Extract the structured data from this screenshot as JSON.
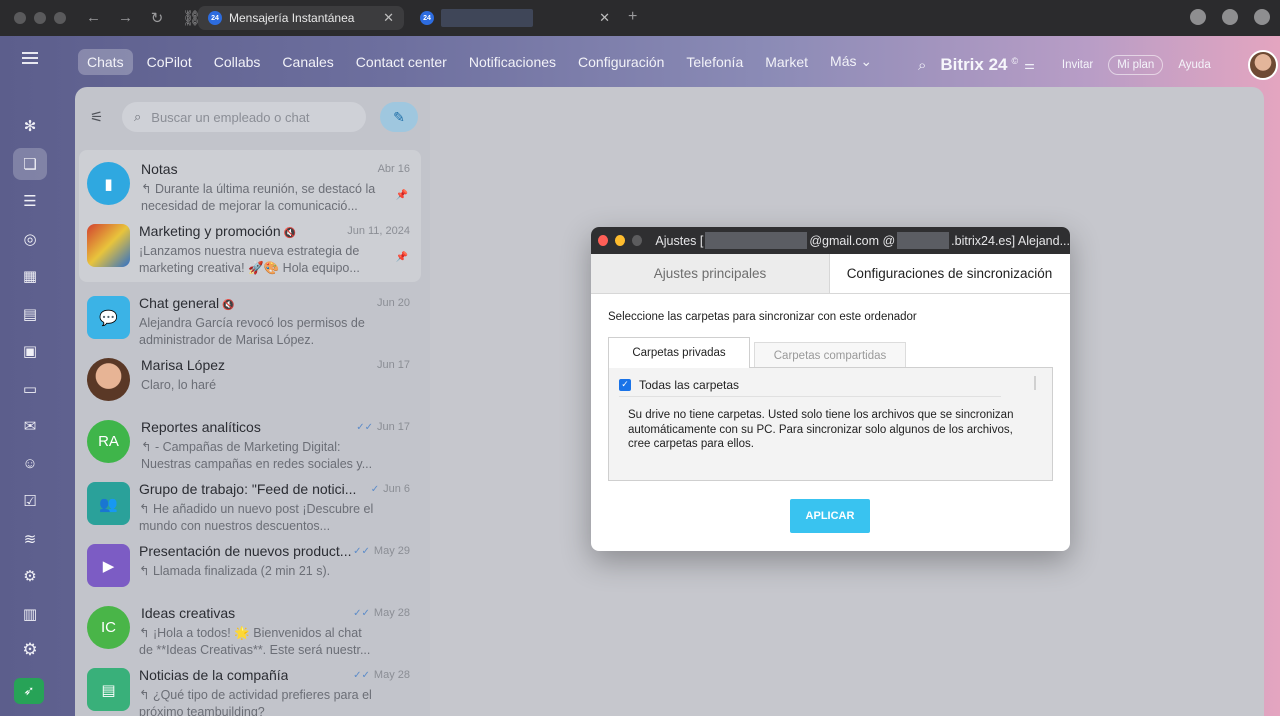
{
  "browser": {
    "tabs": [
      {
        "label": "Mensajería Instantánea",
        "favicon": "24"
      },
      {
        "label": "",
        "favicon": "24"
      }
    ],
    "close_glyph": "✕",
    "new_tab_glyph": "+"
  },
  "topnav": {
    "items": [
      "Chats",
      "CoPilot",
      "Collabs",
      "Canales",
      "Contact center",
      "Notificaciones",
      "Configuración",
      "Telefonía",
      "Market",
      "Más ⌄"
    ],
    "brand": "Bitrix 24",
    "brand_sup": "©",
    "invite": "Invitar",
    "plan": "Mi plan",
    "help": "Ayuda"
  },
  "search": {
    "placeholder": "Buscar un empleado o chat"
  },
  "chats": [
    {
      "title": "Notas",
      "date": "Abr 16",
      "preview": "↰ Durante la última reunión, se destacó la necesidad de mejorar la comunicació...",
      "pinned": true,
      "avatar": "bookmark-icon",
      "color": "#2fa8e0"
    },
    {
      "title": "Marketing y promoción",
      "date": "Jun 11, 2024",
      "preview": "¡Lanzamos nuestra nueva estrategia de marketing creativa! 🚀🎨 Hola equipo...",
      "pinned": true,
      "muted": true,
      "avatar": "image",
      "color": "#c8362f"
    },
    {
      "title": "Chat general",
      "date": "Jun 20",
      "preview": "Alejandra García revocó los permisos de administrador de Marisa López.",
      "muted": true,
      "avatar": "chat-icon",
      "color": "#3bb3e6"
    },
    {
      "title": "Marisa López",
      "date": "Jun 17",
      "preview": "Claro, lo haré",
      "avatar": "photo",
      "color": "#8a5a3c"
    },
    {
      "title": "Reportes analíticos",
      "date": "Jun 17",
      "preview": "↰ - Campañas de Marketing Digital: Nuestras campañas en redes sociales y...",
      "avatar": "RA",
      "color": "#3fb54a",
      "read": true
    },
    {
      "title": "Grupo de trabajo: \"Feed de notici...",
      "date": "Jun 6",
      "preview": "↰ He añadido un nuevo post ¡Descubre el mundo con nuestros descuentos...",
      "avatar": "group-icon",
      "color": "#2aa19a",
      "read": true
    },
    {
      "title": "Presentación de nuevos product...",
      "date": "May 29",
      "preview": "↰ Llamada finalizada (2 min 21 s).",
      "avatar": "video-icon",
      "color": "#7c5cc4",
      "read": true
    },
    {
      "title": "Ideas creativas",
      "date": "May 28",
      "preview": "↰ ¡Hola a todos! 🌟 Bienvenidos al chat de **Ideas Creativas**. Este será nuestr...",
      "avatar": "IC",
      "color": "#49b548",
      "read": true
    },
    {
      "title": "Noticias de la compañía",
      "date": "May 28",
      "preview": "↰ ¿Qué tipo de actividad prefieres para el próximo teambuilding?",
      "avatar": "news-icon",
      "color": "#39b07a",
      "read": true
    }
  ],
  "modal": {
    "title_prefix": "Ajustes [",
    "title_mid": "@gmail.com @",
    "title_suffix": ".bitrix24.es] Alejand...",
    "tabs": [
      "Ajustes principales",
      "Configuraciones de sincronización"
    ],
    "instruction": "Seleccione las carpetas para sincronizar con este ordenador",
    "inner_tabs": [
      "Carpetas privadas",
      "Carpetas compartidas"
    ],
    "all_folders": "Todas las carpetas",
    "message": "Su drive no tiene carpetas. Usted solo tiene los archivos que se sincronizan automáticamente con su PC. Para sincronizar solo algunos de los archivos, cree carpetas para ellos.",
    "apply": "APLICAR"
  },
  "colors": {
    "apply_button": "#39c3f0",
    "checkbox": "#1a73e8",
    "rocket": "#27a357"
  }
}
